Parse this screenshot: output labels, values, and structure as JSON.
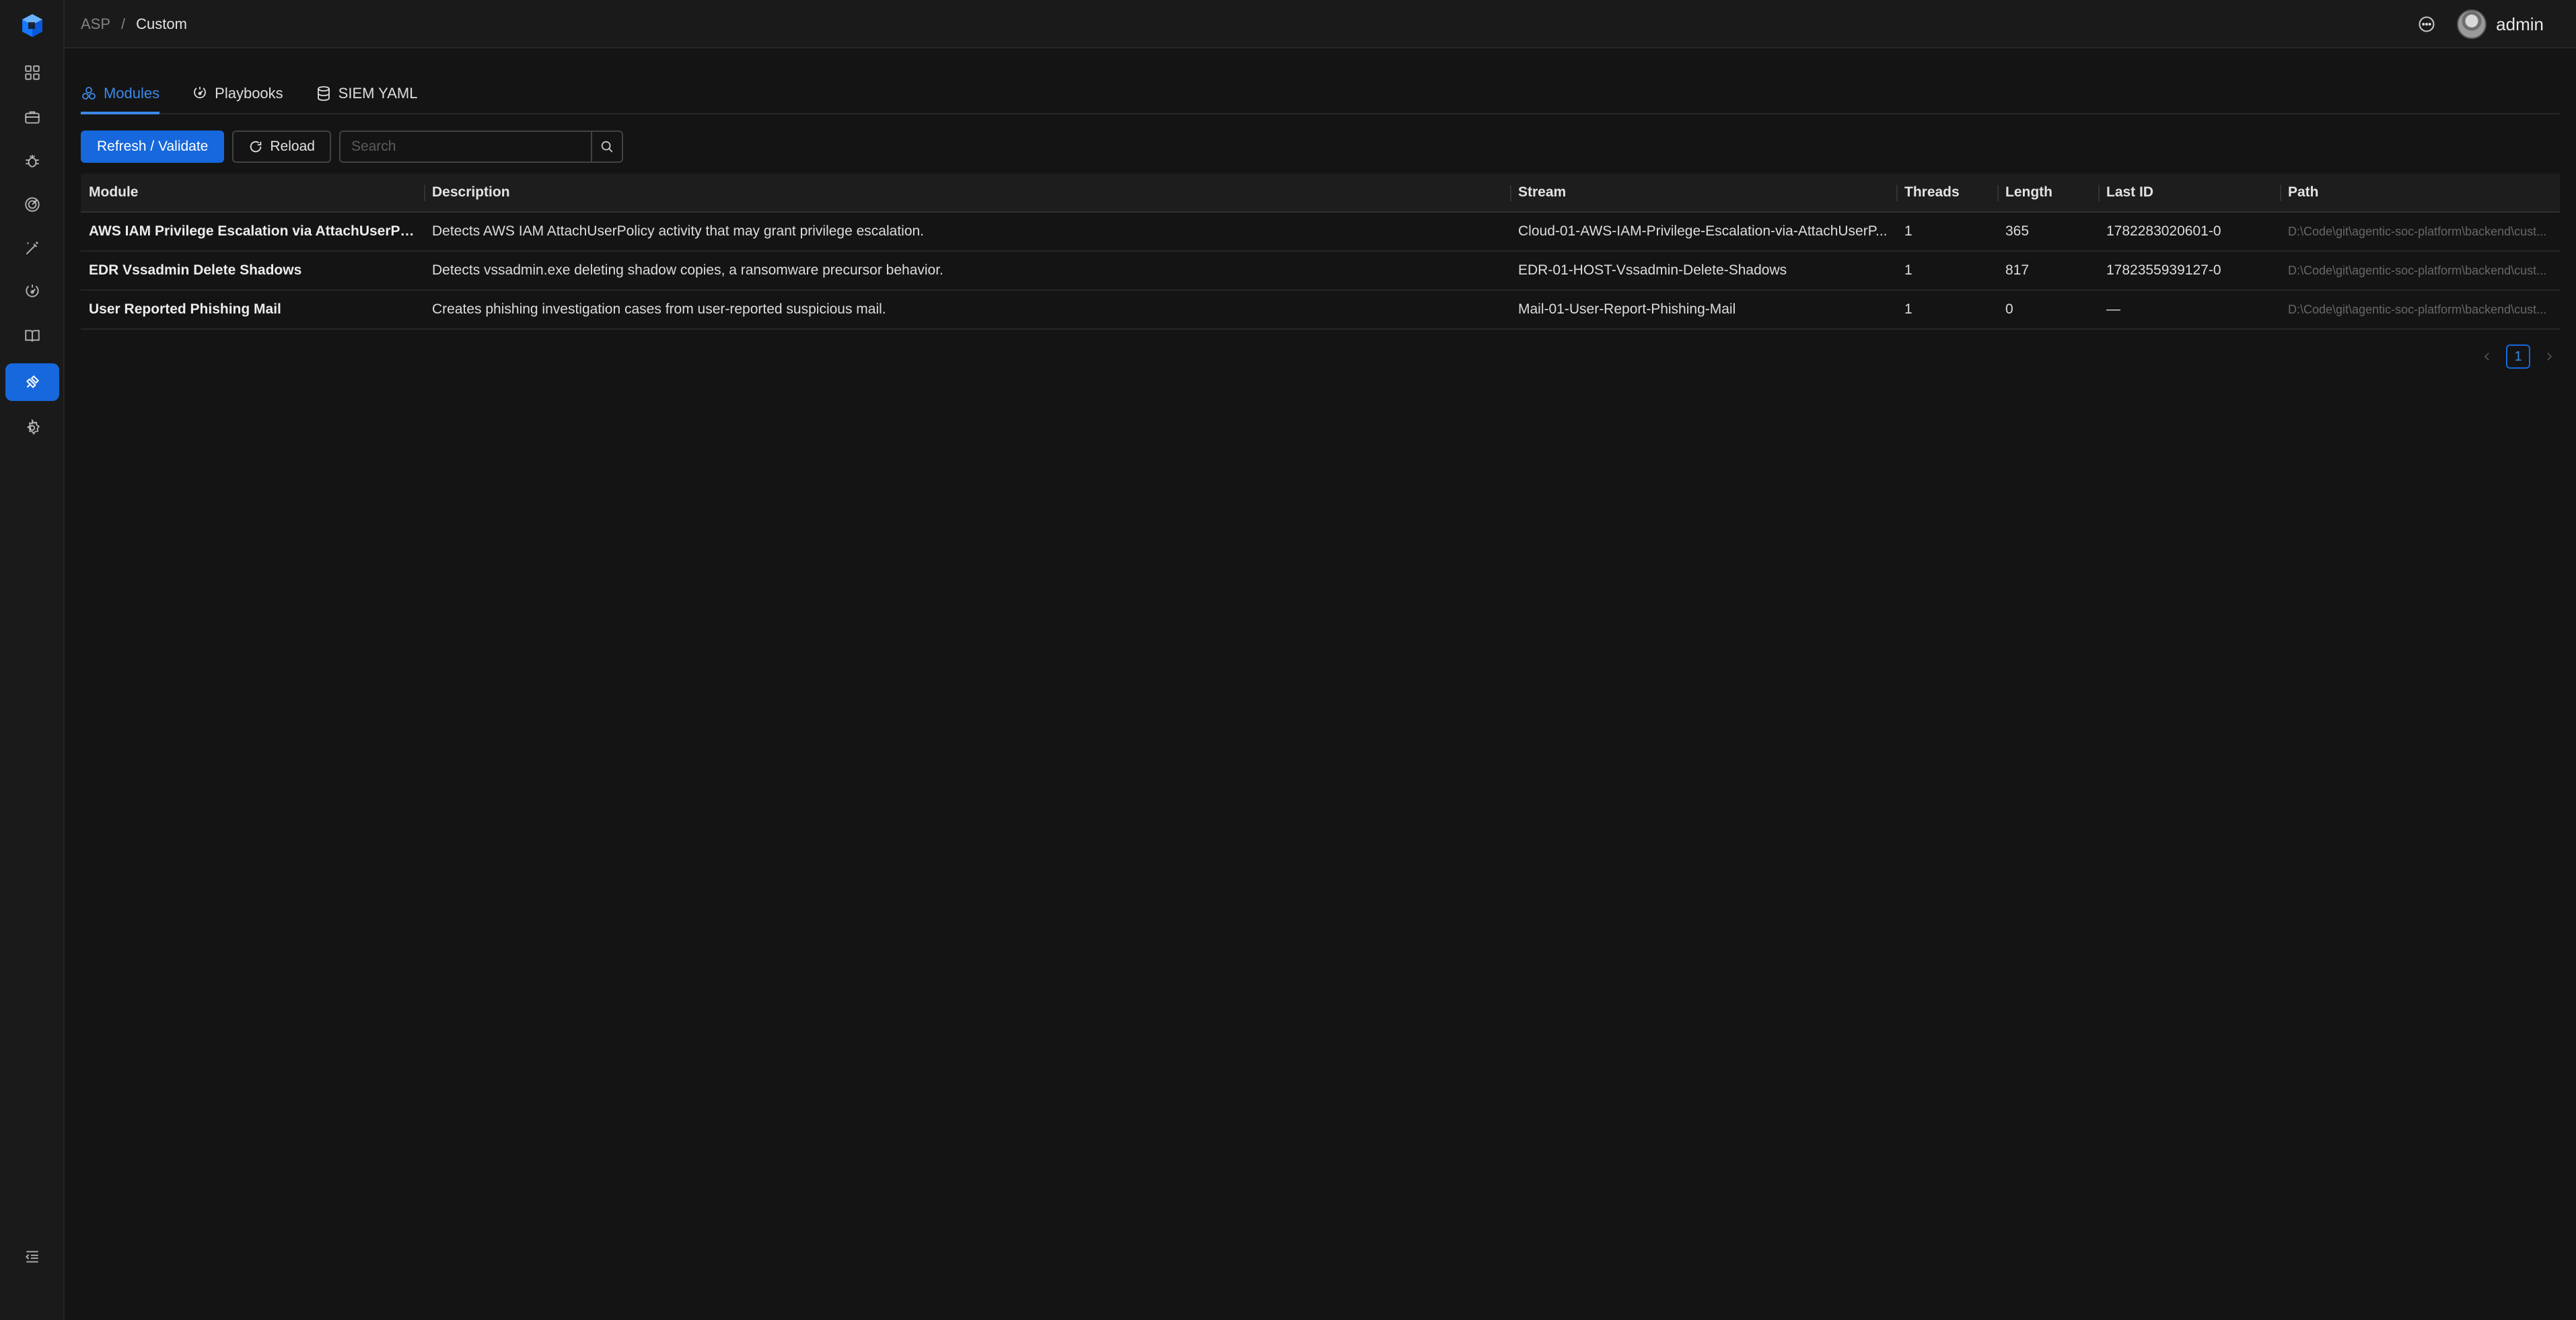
{
  "header": {
    "breadcrumb": {
      "root": "ASP",
      "separator": "/",
      "current": "Custom"
    },
    "user": {
      "name": "admin"
    }
  },
  "sidebar": {
    "items": [
      {
        "icon": "dashboard-icon",
        "active": false
      },
      {
        "icon": "briefcase-icon",
        "active": false
      },
      {
        "icon": "bug-icon",
        "active": false
      },
      {
        "icon": "radar-icon",
        "active": false
      },
      {
        "icon": "magic-wand-icon",
        "active": false
      },
      {
        "icon": "playbook-icon",
        "active": false
      },
      {
        "icon": "book-icon",
        "active": false
      },
      {
        "icon": "plugin-icon",
        "active": true
      },
      {
        "icon": "gear-icon",
        "active": false
      }
    ]
  },
  "tabs": [
    {
      "label": "Modules",
      "active": true
    },
    {
      "label": "Playbooks",
      "active": false
    },
    {
      "label": "SIEM YAML",
      "active": false
    }
  ],
  "toolbar": {
    "refresh_label": "Refresh / Validate",
    "reload_label": "Reload",
    "search_placeholder": "Search"
  },
  "table": {
    "columns": [
      "Module",
      "Description",
      "Stream",
      "Threads",
      "Length",
      "Last ID",
      "Path"
    ],
    "rows": [
      {
        "module": "AWS IAM Privilege Escalation via AttachUserPolicy",
        "description": "Detects AWS IAM AttachUserPolicy activity that may grant privilege escalation.",
        "stream": "Cloud-01-AWS-IAM-Privilege-Escalation-via-AttachUserP...",
        "threads": "1",
        "length": "365",
        "last_id": "1782283020601-0",
        "path": "D:\\Code\\git\\agentic-soc-platform\\backend\\cust..."
      },
      {
        "module": "EDR Vssadmin Delete Shadows",
        "description": "Detects vssadmin.exe deleting shadow copies, a ransomware precursor behavior.",
        "stream": "EDR-01-HOST-Vssadmin-Delete-Shadows",
        "threads": "1",
        "length": "817",
        "last_id": "1782355939127-0",
        "path": "D:\\Code\\git\\agentic-soc-platform\\backend\\cust..."
      },
      {
        "module": "User Reported Phishing Mail",
        "description": "Creates phishing investigation cases from user-reported suspicious mail.",
        "stream": "Mail-01-User-Report-Phishing-Mail",
        "threads": "1",
        "length": "0",
        "last_id": "—",
        "path": "D:\\Code\\git\\agentic-soc-platform\\backend\\cust..."
      }
    ]
  },
  "pagination": {
    "current_page": "1"
  },
  "colors": {
    "accent": "#1668dc",
    "accent_text": "#3c89e8",
    "background": "#141414"
  }
}
